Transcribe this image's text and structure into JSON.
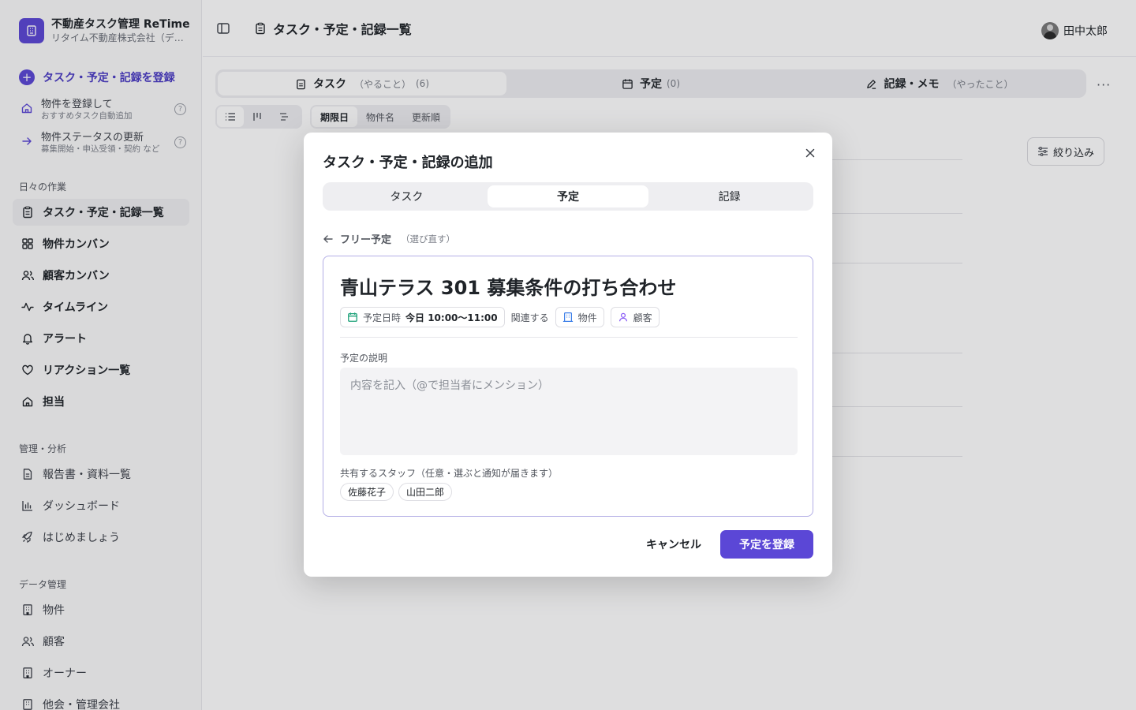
{
  "brand": {
    "name": "不動産タスク管理 ReTime",
    "company": "リタイム不動産株式会社（デモ）"
  },
  "sidebar": {
    "primary_action": "タスク・予定・記録を登録",
    "sub_actions": [
      {
        "title": "物件を登録して",
        "subtitle": "おすすめタスク自動追加",
        "help": "?"
      },
      {
        "title": "物件ステータスの更新",
        "subtitle": "募集開始・申込受領・契約 など",
        "help": "?"
      }
    ],
    "sections": {
      "daily": "日々の作業",
      "management": "管理・分析",
      "data": "データ管理"
    },
    "daily_items": [
      {
        "label": "タスク・予定・記録一覧",
        "icon": "clipboard-icon"
      },
      {
        "label": "物件カンバン",
        "icon": "grid-icon"
      },
      {
        "label": "顧客カンバン",
        "icon": "users-icon"
      },
      {
        "label": "タイムライン",
        "icon": "activity-icon"
      },
      {
        "label": "アラート",
        "icon": "bell-icon"
      },
      {
        "label": "リアクション一覧",
        "icon": "heart-icon"
      },
      {
        "label": "担当",
        "icon": "home-icon"
      }
    ],
    "management_items": [
      {
        "label": "報告書・資料一覧",
        "icon": "document-icon"
      },
      {
        "label": "ダッシュボード",
        "icon": "bar-chart-icon"
      },
      {
        "label": "はじめましょう",
        "icon": "rocket-icon"
      }
    ],
    "data_items": [
      {
        "label": "物件",
        "icon": "building-icon"
      },
      {
        "label": "顧客",
        "icon": "users-icon"
      },
      {
        "label": "オーナー",
        "icon": "building-icon"
      },
      {
        "label": "他会・管理会社",
        "icon": "building-icon"
      }
    ]
  },
  "header": {
    "title": "タスク・予定・記録一覧",
    "user_name": "田中太郎"
  },
  "main": {
    "tabs": [
      {
        "label": "タスク",
        "sub": "（やること）",
        "count": "(6)"
      },
      {
        "label": "予定",
        "sub": "",
        "count": "(0)"
      },
      {
        "label": "記録・メモ",
        "sub": "（やったこと）",
        "count": ""
      }
    ],
    "sort_options": [
      "期限日",
      "物件名",
      "更新順"
    ],
    "filter_label": "絞り込み",
    "more": "···"
  },
  "modal": {
    "title": "タスク・予定・記録の追加",
    "segments": [
      "タスク",
      "予定",
      "記録"
    ],
    "selected_segment": "予定",
    "back_label": "フリー予定",
    "back_hint": "（選び直す）",
    "event_title": "青山テラス 301 募集条件の打ち合わせ",
    "date_chip": {
      "key": "予定日時",
      "value": "今日 10:00〜11:00"
    },
    "related_label": "関連する",
    "property_chip": "物件",
    "customer_chip": "顧客",
    "description_label": "予定の説明",
    "description_placeholder": "内容を記入（@で担当者にメンション）",
    "staff_label": "共有するスタッフ（任意・選ぶと通知が届きます）",
    "staff": [
      "佐藤花子",
      "山田二郎"
    ],
    "cancel_label": "キャンセル",
    "submit_label": "予定を登録"
  },
  "colors": {
    "accent": "#5b47d6",
    "date_icon": "#1ea27a",
    "customer_icon": "#8a5cf6"
  }
}
